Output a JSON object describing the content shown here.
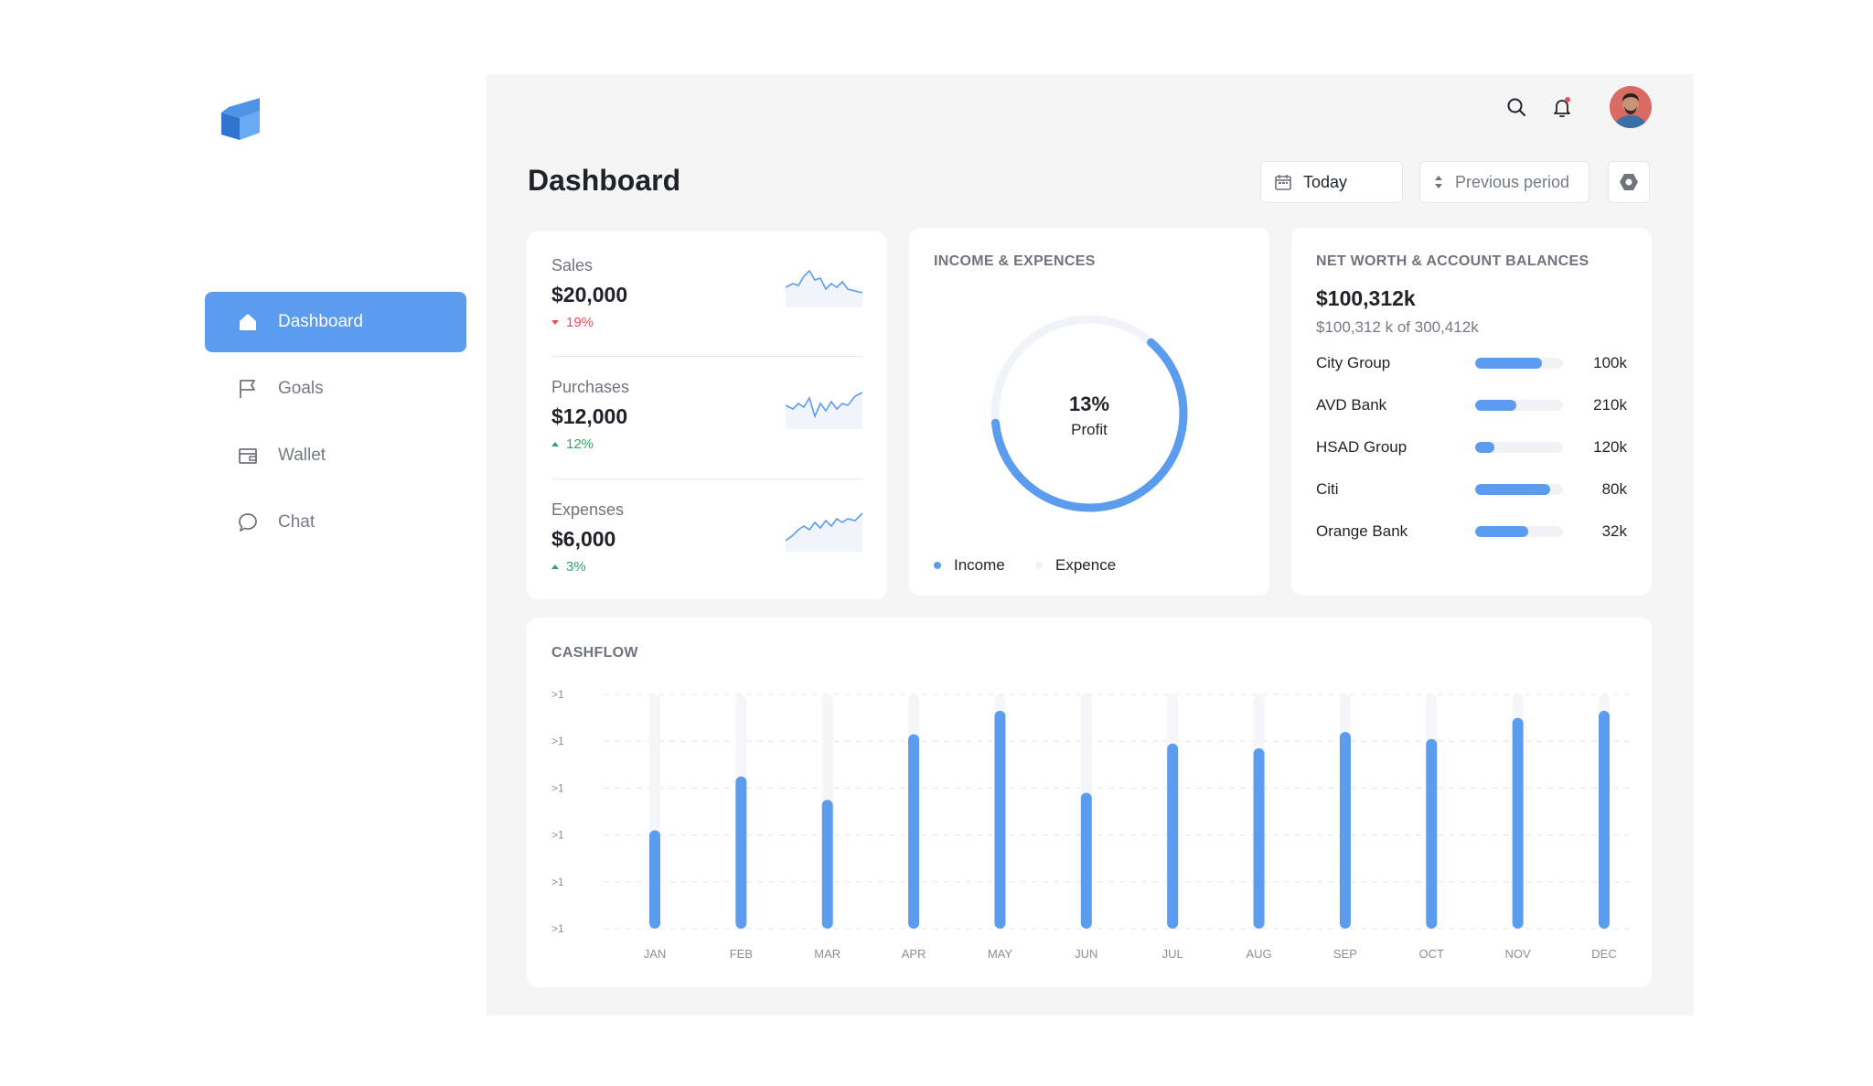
{
  "sidebar": {
    "items": [
      {
        "label": "Dashboard",
        "icon": "home-icon",
        "active": true
      },
      {
        "label": "Goals",
        "icon": "flag-icon",
        "active": false
      },
      {
        "label": "Wallet",
        "icon": "wallet-icon",
        "active": false
      },
      {
        "label": "Chat",
        "icon": "chat-icon",
        "active": false
      }
    ]
  },
  "header": {
    "title": "Dashboard",
    "date_button": "Today",
    "period_select": "Previous period",
    "settings_icon": "settings-icon",
    "search_icon": "search-icon",
    "notification_icon": "bell-icon",
    "notification_dot_color": "#ea4d58"
  },
  "kpis": [
    {
      "label": "Sales",
      "value": "$20,000",
      "change": "19%",
      "direction": "down"
    },
    {
      "label": "Purchases",
      "value": "$12,000",
      "change": "12%",
      "direction": "up"
    },
    {
      "label": "Expenses",
      "value": "$6,000",
      "change": "3%",
      "direction": "up"
    }
  ],
  "income": {
    "title": "INCOME & EXPENCES",
    "percent": "13%",
    "percent_value": 0.62,
    "center_label": "Profit",
    "legend": [
      {
        "label": "Income",
        "color": "#5b9cef"
      },
      {
        "label": "Expence",
        "color": "#eef1f6"
      }
    ]
  },
  "networth": {
    "title": "NET WORTH & ACCOUNT BALANCES",
    "total": "$100,312k",
    "subtitle": "$100,312 k of 300,412k",
    "accounts": [
      {
        "name": "City Group",
        "amount": "100k",
        "fraction": 0.76
      },
      {
        "name": "AVD Bank",
        "amount": "210k",
        "fraction": 0.47
      },
      {
        "name": "HSAD Group",
        "amount": "120k",
        "fraction": 0.22
      },
      {
        "name": "Citi",
        "amount": "80k",
        "fraction": 0.85
      },
      {
        "name": "Orange Bank",
        "amount": "32k",
        "fraction": 0.6
      }
    ]
  },
  "colors": {
    "accent": "#5b9cef",
    "track": "#f0f2f5",
    "down": "#ea4d58",
    "up": "#32a36b"
  },
  "chart_data": {
    "type": "bar",
    "title": "CASHFLOW",
    "categories": [
      "JAN",
      "FEB",
      "MAR",
      "APR",
      "MAY",
      "JUN",
      "JUL",
      "AUG",
      "SEP",
      "OCT",
      "NOV",
      "DEC"
    ],
    "values": [
      0.42,
      0.65,
      0.55,
      0.83,
      0.93,
      0.58,
      0.79,
      0.77,
      0.84,
      0.81,
      0.9,
      0.93
    ],
    "ytick_labels": [
      ">1",
      ">1",
      ">1",
      ">1",
      ">1",
      ">1"
    ],
    "ylim": [
      0,
      1
    ],
    "grid": true
  }
}
